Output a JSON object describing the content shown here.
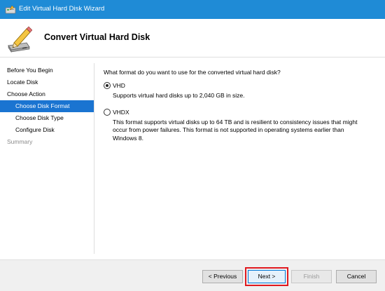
{
  "window": {
    "title": "Edit Virtual Hard Disk Wizard"
  },
  "header": {
    "title": "Convert Virtual Hard Disk",
    "icon": "pencil-disk-icon"
  },
  "nav": {
    "items": [
      {
        "label": "Before You Begin",
        "state": "normal"
      },
      {
        "label": "Locate Disk",
        "state": "normal"
      },
      {
        "label": "Choose Action",
        "state": "normal"
      },
      {
        "label": "Choose Disk Format",
        "state": "active"
      },
      {
        "label": "Choose Disk Type",
        "state": "normal"
      },
      {
        "label": "Configure Disk",
        "state": "normal"
      },
      {
        "label": "Summary",
        "state": "disabled"
      }
    ]
  },
  "content": {
    "question": "What format do you want to use for the converted virtual hard disk?",
    "options": [
      {
        "label": "VHD",
        "checked": true,
        "description": "Supports virtual hard disks up to 2,040 GB in size."
      },
      {
        "label": "VHDX",
        "checked": false,
        "description": "This format supports virtual disks up to 64 TB and is resilient to consistency issues that might occur from power failures. This format is not supported in operating systems earlier than Windows 8."
      }
    ]
  },
  "footer": {
    "previous_label": "< Previous",
    "next_label": "Next >",
    "finish_label": "Finish",
    "cancel_label": "Cancel"
  },
  "colors": {
    "titlebar": "#1f8bd6",
    "nav_active": "#1a74d1",
    "highlight_box": "#e0191f"
  }
}
